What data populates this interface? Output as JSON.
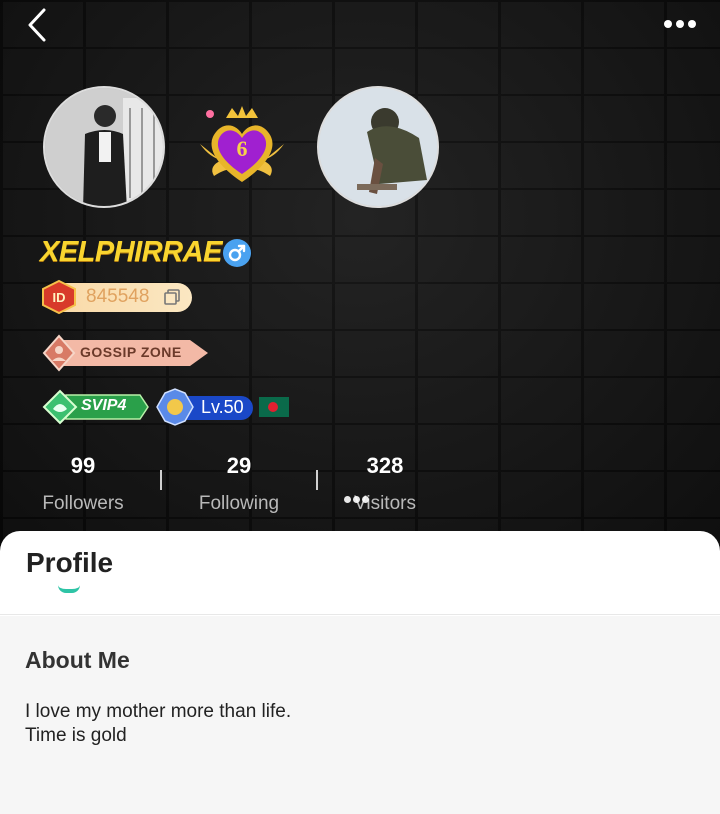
{
  "header": {
    "back_icon": "chevron-left-icon",
    "more_icon": "more-horizontal-icon"
  },
  "profile": {
    "username": "XELPHIRRAE",
    "gender_icon": "male-icon",
    "gender_color": "#4aa2f0",
    "id_number": "845548",
    "id_medal_label": "ID",
    "frame_level": "6",
    "badge_gossip": "GOSSIP ZONE",
    "svip_label": "SVIP4",
    "level_label": "Lv.50",
    "flag": "bangladesh-flag-icon",
    "username_color": "#f9d52f"
  },
  "stats": {
    "followers": {
      "value": "99",
      "label": "Followers"
    },
    "following": {
      "value": "29",
      "label": "Following"
    },
    "visitors": {
      "value": "328",
      "label": "Visitors"
    }
  },
  "tabs": {
    "profile_label": "Profile",
    "accent_color": "#2ec4a6"
  },
  "about": {
    "title": "About Me",
    "lines": [
      "I love my mother more than life.",
      "Time is gold"
    ]
  }
}
